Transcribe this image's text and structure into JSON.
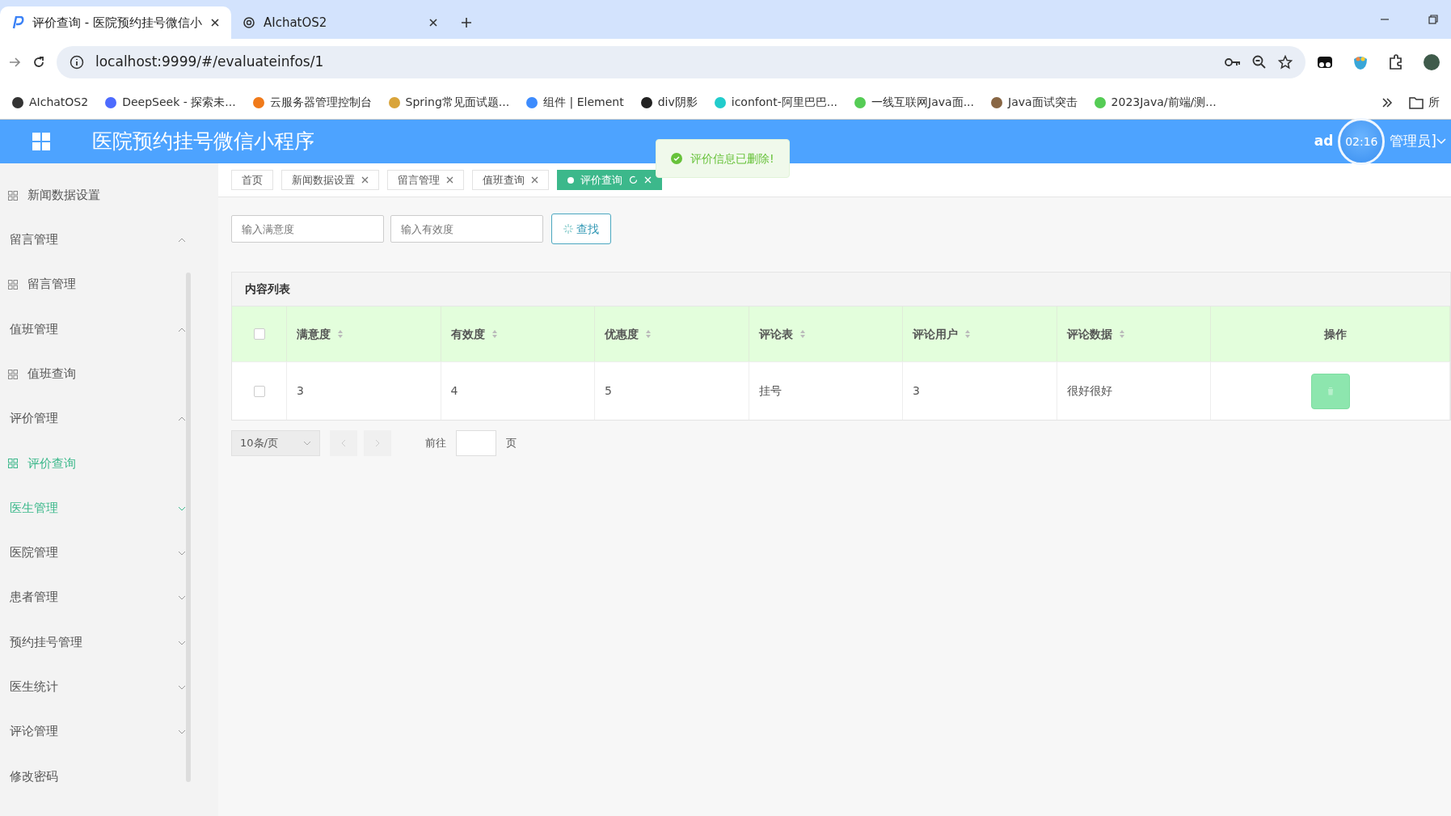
{
  "browser": {
    "tabs": [
      {
        "title": "评价查询 - 医院预约挂号微信小",
        "selected": true
      },
      {
        "title": "AIchatOS2",
        "selected": false
      }
    ],
    "address": "localhost:9999/#/evaluateinfos/1",
    "bookmarks": [
      "AIchatOS2",
      "DeepSeek - 探索未...",
      "云服务器管理控制台",
      "Spring常见面试题...",
      "组件 | Element",
      "div阴影",
      "iconfont-阿里巴巴...",
      "一线互联网Java面...",
      "Java面试突击",
      "2023Java/前端/测..."
    ],
    "bookmark_folder": "所"
  },
  "header": {
    "title": "医院预约挂号微信小程序",
    "user_start": "ad",
    "user_end": "管理员]",
    "timer": "02:16"
  },
  "toast": {
    "message": "评价信息已删除!"
  },
  "sidebar": {
    "items": [
      {
        "kind": "item",
        "label": "新闻数据设置",
        "selected": false,
        "highlighted": false
      },
      {
        "kind": "group",
        "label": "留言管理",
        "expanded": true,
        "highlighted": false
      },
      {
        "kind": "item",
        "label": "留言管理",
        "selected": false,
        "highlighted": false
      },
      {
        "kind": "group",
        "label": "值班管理",
        "expanded": true,
        "highlighted": false
      },
      {
        "kind": "item",
        "label": "值班查询",
        "selected": false,
        "highlighted": false
      },
      {
        "kind": "group",
        "label": "评价管理",
        "expanded": true,
        "highlighted": false
      },
      {
        "kind": "item",
        "label": "评价查询",
        "selected": true,
        "highlighted": false
      },
      {
        "kind": "group",
        "label": "医生管理",
        "expanded": false,
        "highlighted": true
      },
      {
        "kind": "group",
        "label": "医院管理",
        "expanded": false,
        "highlighted": false
      },
      {
        "kind": "group",
        "label": "患者管理",
        "expanded": false,
        "highlighted": false
      },
      {
        "kind": "group",
        "label": "预约挂号管理",
        "expanded": false,
        "highlighted": false
      },
      {
        "kind": "group",
        "label": "医生统计",
        "expanded": false,
        "highlighted": false
      },
      {
        "kind": "group",
        "label": "评论管理",
        "expanded": false,
        "highlighted": false
      },
      {
        "kind": "link",
        "label": "修改密码",
        "highlighted": false
      }
    ]
  },
  "page_tabs": [
    {
      "label": "首页",
      "closable": false,
      "selected": false
    },
    {
      "label": "新闻数据设置",
      "closable": true,
      "selected": false
    },
    {
      "label": "留言管理",
      "closable": true,
      "selected": false
    },
    {
      "label": "值班查询",
      "closable": true,
      "selected": false
    },
    {
      "label": "评价查询",
      "closable": true,
      "selected": true
    }
  ],
  "filters": [
    {
      "placeholder": "输入满意度"
    },
    {
      "placeholder": "输入有效度"
    }
  ],
  "search_button": "查找",
  "table": {
    "title": "内容列表",
    "columns": [
      "满意度",
      "有效度",
      "优惠度",
      "评论表",
      "评论用户",
      "评论数据"
    ],
    "action_column": "操作",
    "header_checked": false,
    "rows": [
      {
        "checked": false,
        "cells": [
          "3",
          "4",
          "5",
          "挂号",
          "3",
          "很好很好"
        ]
      }
    ]
  },
  "pagination": {
    "page_size": "10条/页",
    "goto": "前往",
    "page_unit": "页"
  }
}
